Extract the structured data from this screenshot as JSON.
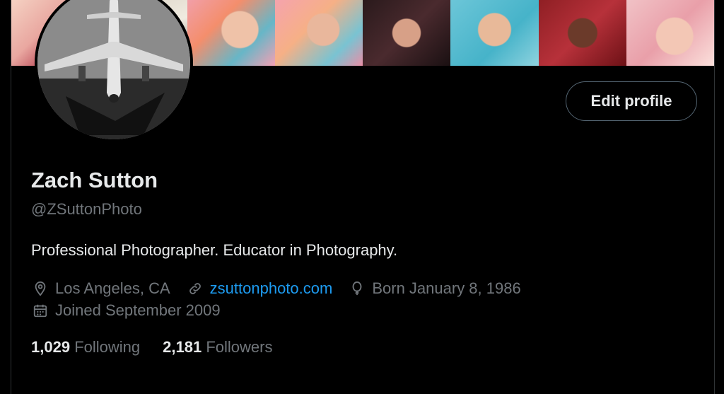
{
  "profile": {
    "name": "Zach Sutton",
    "handle": "@ZSuttonPhoto",
    "bio": "Professional Photographer. Educator in Photography.",
    "location": "Los Angeles, CA",
    "website": "zsuttonphoto.com",
    "birthday": "Born January 8, 1986",
    "joined": "Joined September 2009",
    "following_count": "1,029",
    "following_label": "Following",
    "followers_count": "2,181",
    "followers_label": "Followers"
  },
  "actions": {
    "edit_profile_label": "Edit profile"
  },
  "icons": {
    "location": "location-pin-icon",
    "website": "link-icon",
    "birthday": "balloon-icon",
    "joined": "calendar-icon"
  },
  "colors": {
    "background": "#000000",
    "text": "#e7e9ea",
    "muted": "#71767b",
    "link": "#1d9bf0",
    "border": "#536471"
  }
}
